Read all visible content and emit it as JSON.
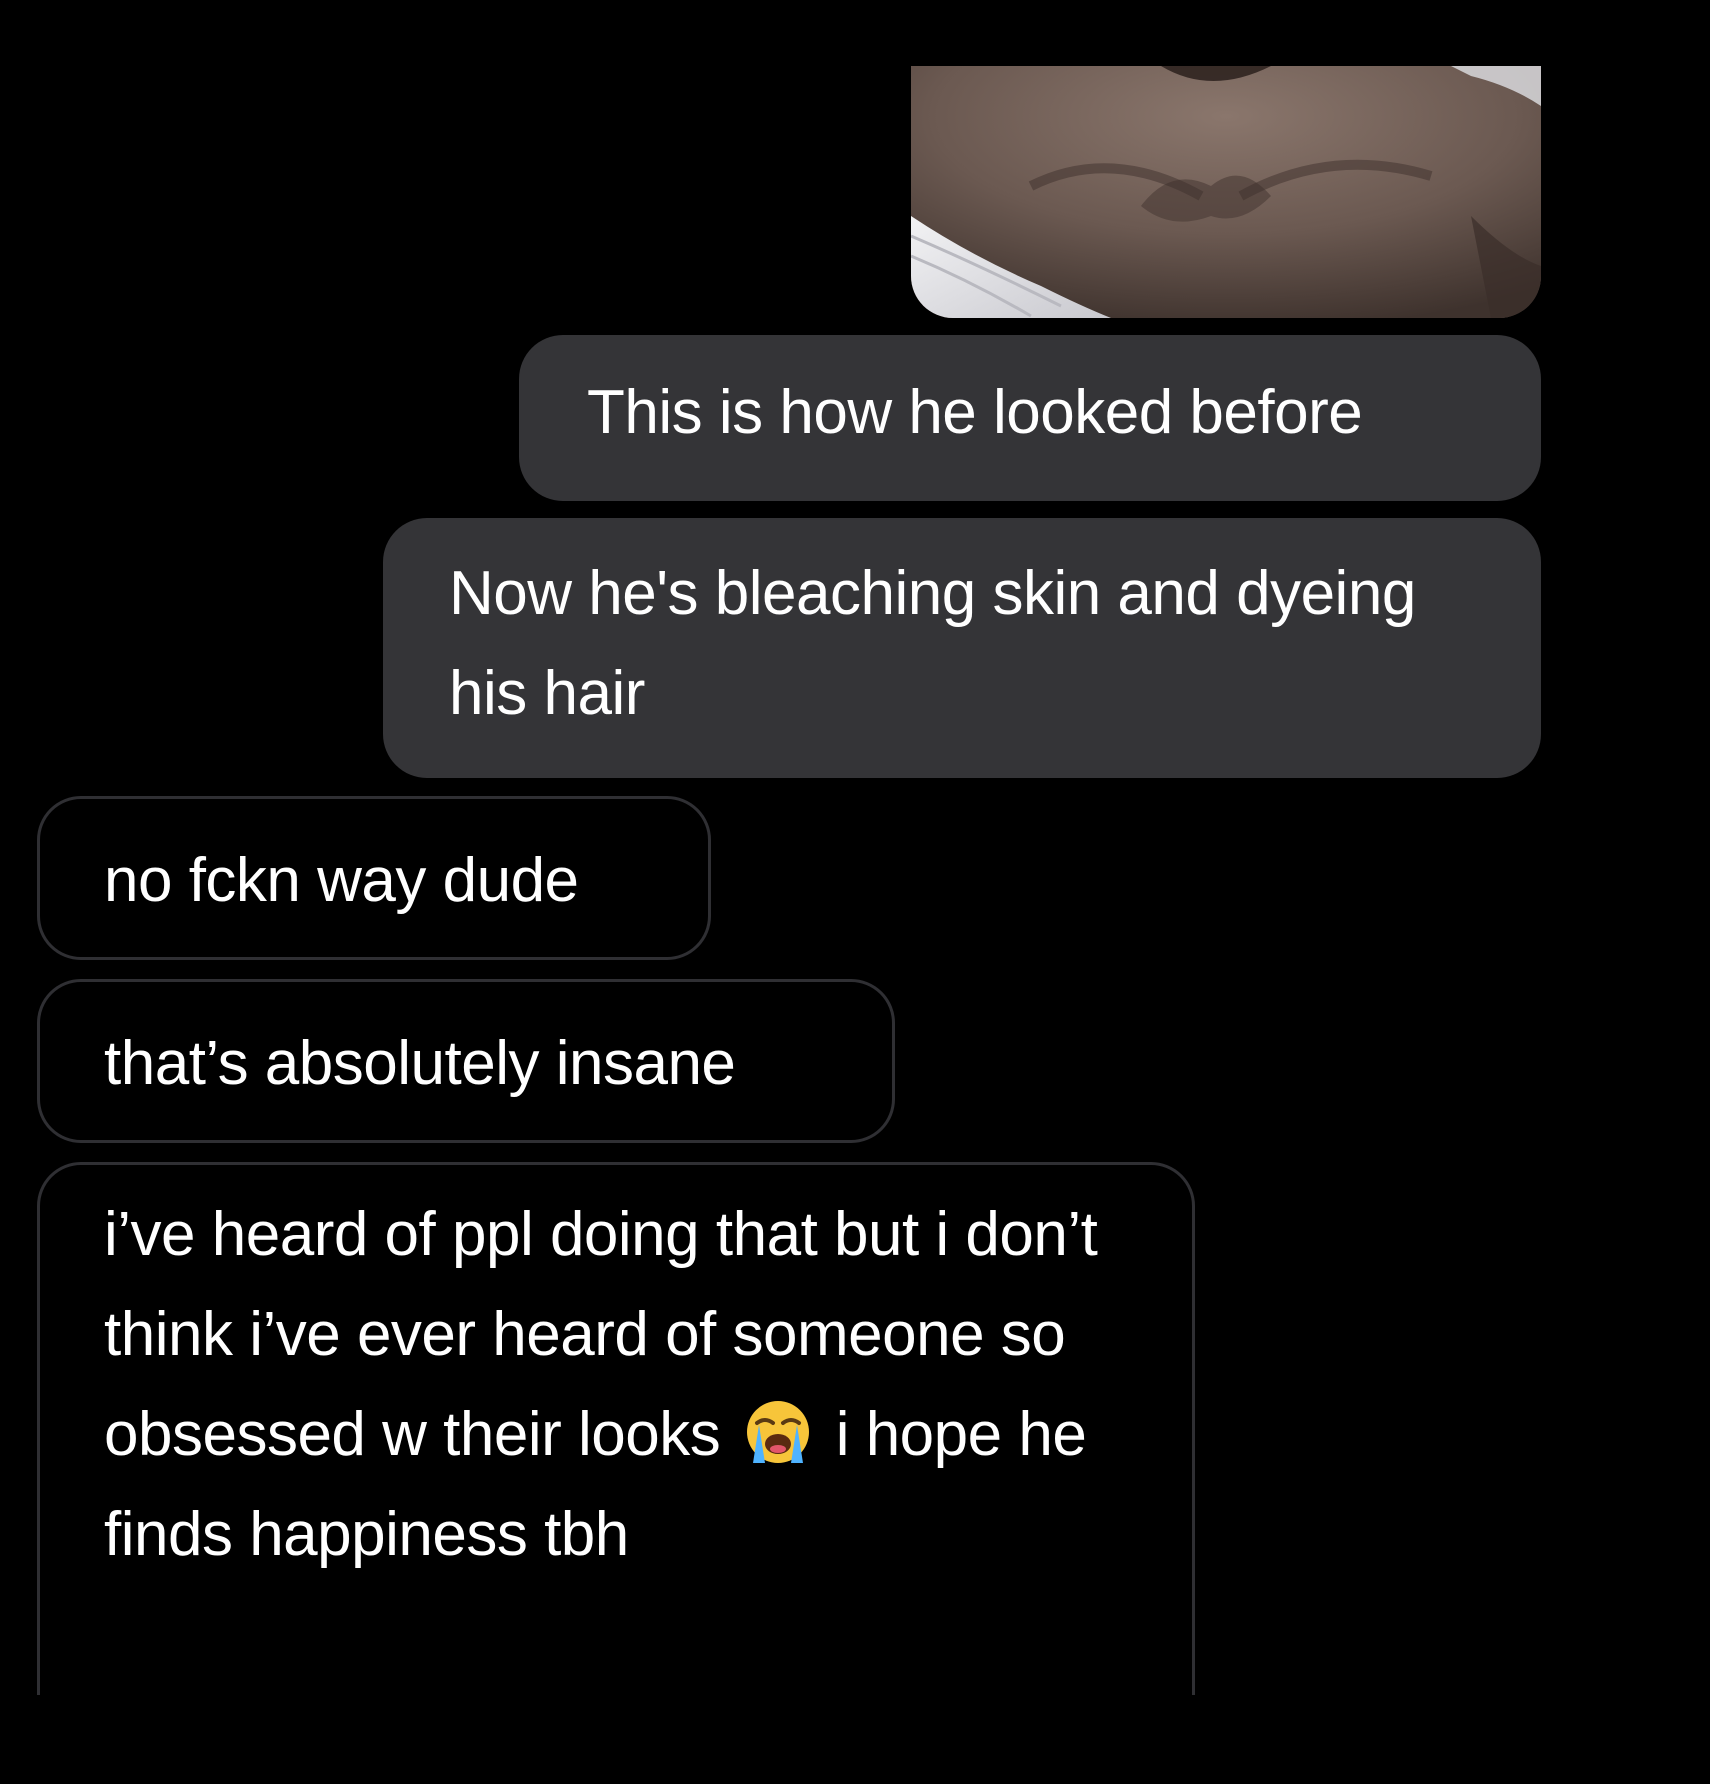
{
  "conversation": {
    "messages": [
      {
        "direction": "sent",
        "type": "image",
        "image_icon": "photo-thumbnail"
      },
      {
        "direction": "sent",
        "type": "text",
        "text": "This is how he looked before"
      },
      {
        "direction": "sent",
        "type": "text",
        "text": "Now he's bleaching skin and dyeing his hair"
      },
      {
        "direction": "received",
        "type": "text",
        "text": "no fckn way dude"
      },
      {
        "direction": "received",
        "type": "text",
        "text": "that’s absolutely insane"
      },
      {
        "direction": "received",
        "type": "text",
        "text_before_emoji": "i’ve heard of ppl doing that but i don’t think i’ve ever heard of someone so obsessed w their looks",
        "emoji": "loudly-crying-face",
        "text_after_emoji": "i hope he finds happiness tbh"
      }
    ]
  },
  "colors": {
    "background": "#000000",
    "sent_bubble": "#343437",
    "received_border": "#2f2f33",
    "text": "#ffffff"
  }
}
